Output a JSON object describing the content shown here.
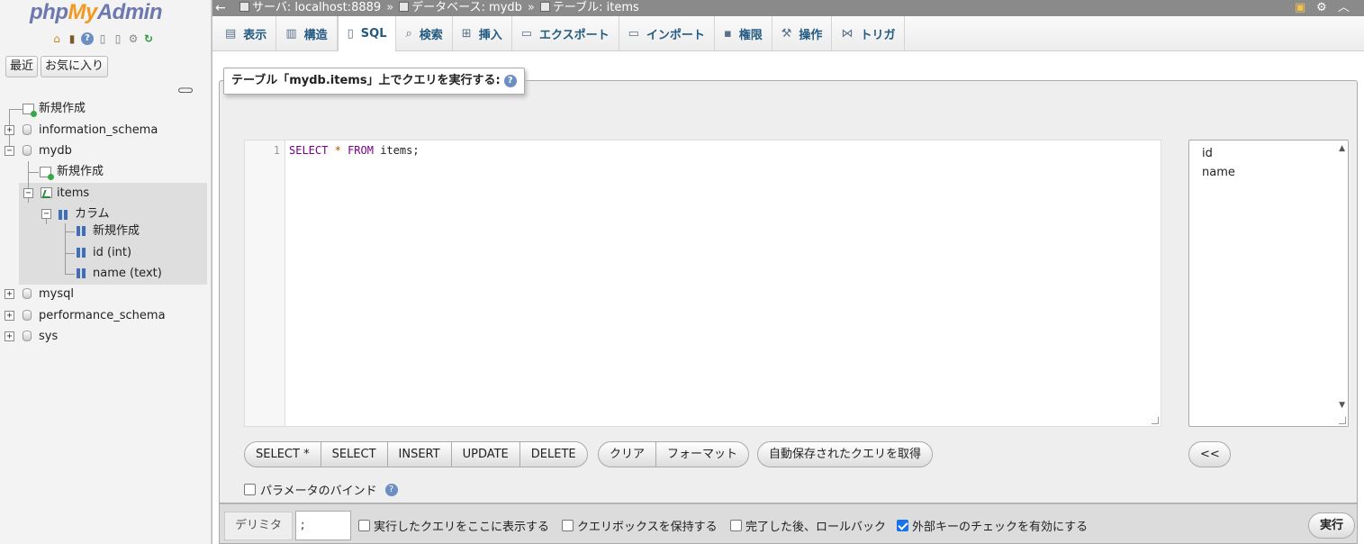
{
  "sidebar": {
    "logo": {
      "php": "php",
      "my": "My",
      "admin": "Admin"
    },
    "tabs": {
      "recent": "最近",
      "favorites": "お気に入り"
    },
    "tree": {
      "new": "新規作成",
      "information_schema": "information_schema",
      "mydb": "mydb",
      "mydb_new": "新規作成",
      "items": "items",
      "columns": "カラム",
      "columns_new": "新規作成",
      "col_id": "id (int)",
      "col_name": "name (text)",
      "mysql": "mysql",
      "performance_schema": "performance_schema",
      "sys": "sys"
    }
  },
  "topbar": {
    "server": "サーバ: localhost:8889",
    "database": "データベース: mydb",
    "table": "テーブル: items",
    "separator": "»"
  },
  "tabs": [
    {
      "label": "表示",
      "icon": "browse-icon"
    },
    {
      "label": "構造",
      "icon": "structure-icon"
    },
    {
      "label": "SQL",
      "icon": "sql-icon"
    },
    {
      "label": "検索",
      "icon": "search-icon"
    },
    {
      "label": "挿入",
      "icon": "insert-icon"
    },
    {
      "label": "エクスポート",
      "icon": "export-icon"
    },
    {
      "label": "インポート",
      "icon": "import-icon"
    },
    {
      "label": "権限",
      "icon": "privileges-icon"
    },
    {
      "label": "操作",
      "icon": "wrench-icon"
    },
    {
      "label": "トリガ",
      "icon": "triggers-icon"
    }
  ],
  "query": {
    "legend": "テーブル「mydb.items」上でクエリを実行する:",
    "line_number": "1",
    "code": {
      "kw1": "SELECT",
      "star": "*",
      "kw2": "FROM",
      "rest": "items;"
    },
    "columns": [
      "id",
      "name"
    ],
    "buttons": {
      "select_star": "SELECT *",
      "select": "SELECT",
      "insert": "INSERT",
      "update": "UPDATE",
      "delete": "DELETE",
      "clear": "クリア",
      "format": "フォーマット",
      "get_autosaved": "自動保存されたクエリを取得",
      "insert_column": "<<"
    },
    "bind_params": "パラメータのバインド"
  },
  "footer": {
    "delimiter_label": "デリミタ",
    "delimiter_value": ";",
    "show_query": "実行したクエリをここに表示する",
    "retain_box": "クエリボックスを保持する",
    "rollback": "完了した後、ロールバック",
    "fk_checks": "外部キーのチェックを有効にする",
    "go": "実行"
  },
  "colors": {
    "accent": "#235a81",
    "topbar": "#8a8a8a",
    "checkbox_checked": "#1a73e8"
  }
}
